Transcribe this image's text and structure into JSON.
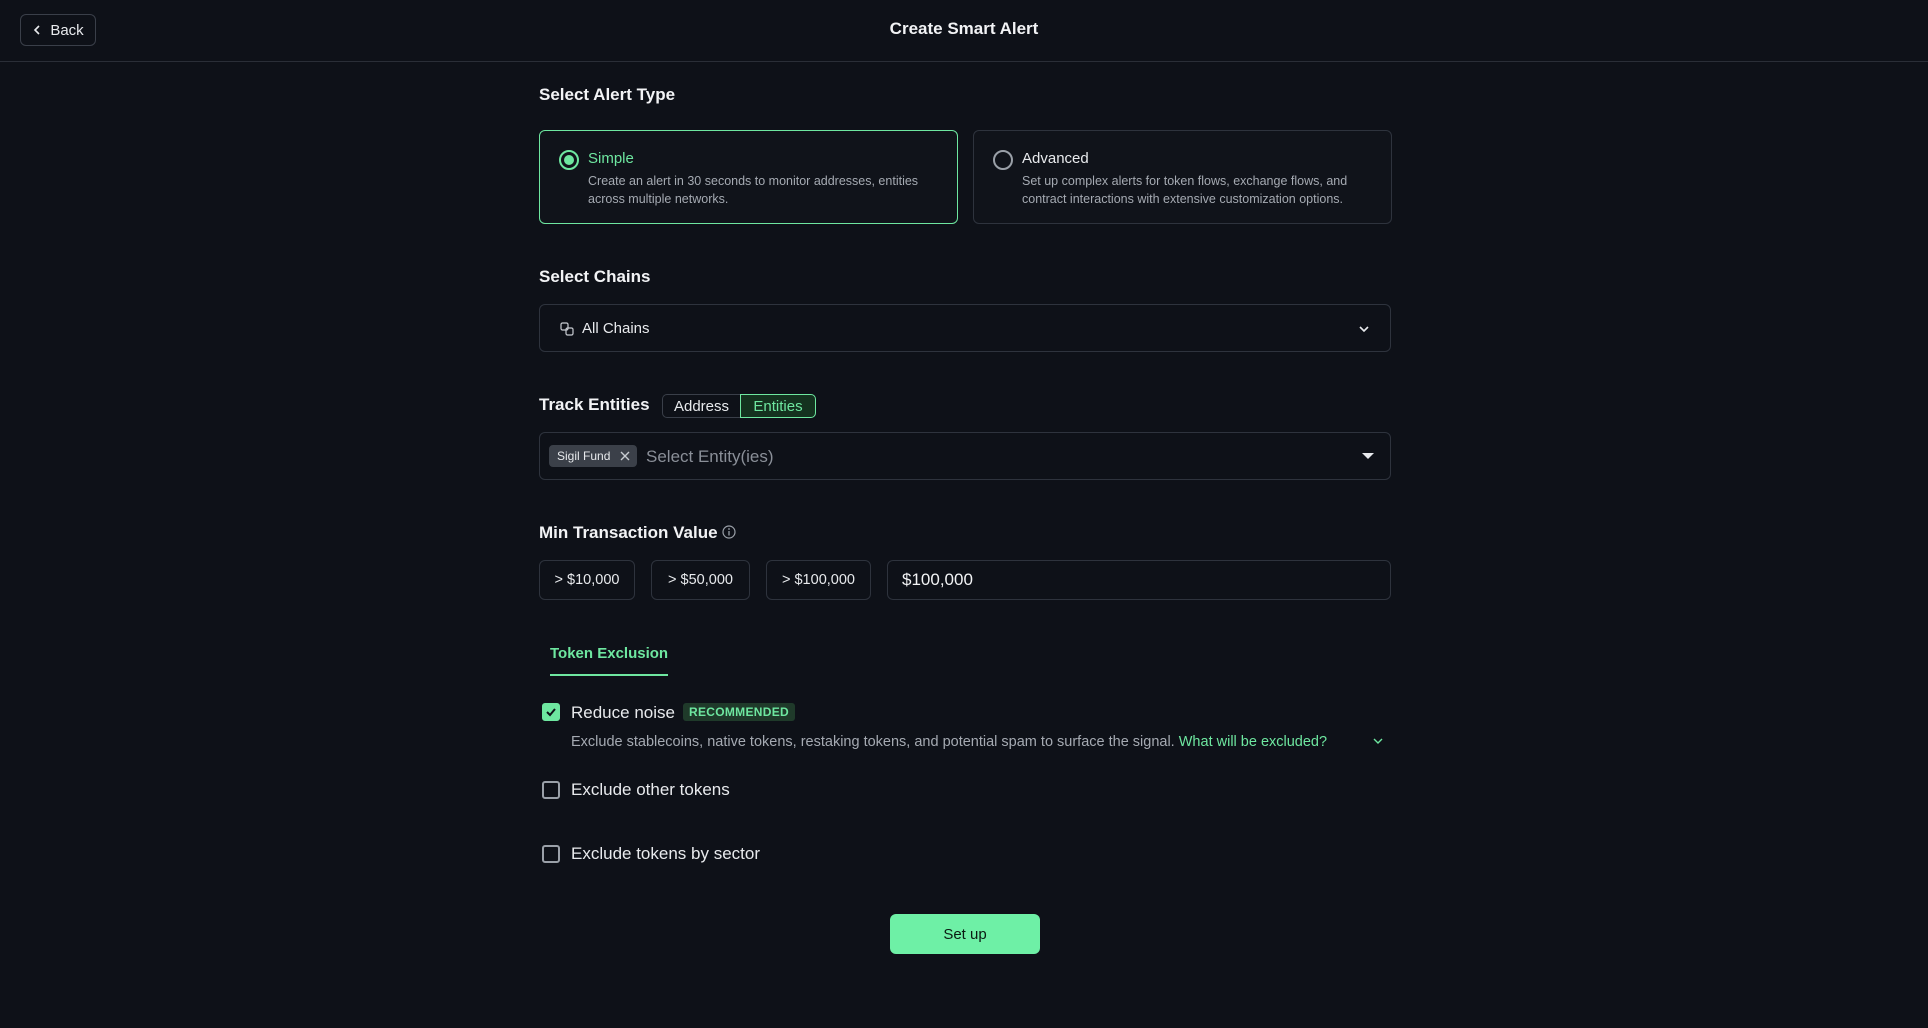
{
  "header": {
    "back_label": "Back",
    "title": "Create Smart Alert"
  },
  "alert_type": {
    "title": "Select Alert Type",
    "options": [
      {
        "name": "Simple",
        "description": "Create an alert in 30 seconds to monitor addresses, entities across multiple networks.",
        "selected": true
      },
      {
        "name": "Advanced",
        "description": "Set up complex alerts for token flows, exchange flows, and contract interactions with extensive customization options.",
        "selected": false
      }
    ]
  },
  "chains": {
    "title": "Select Chains",
    "value": "All Chains"
  },
  "track": {
    "title": "Track Entities",
    "toggle": [
      "Address",
      "Entities"
    ],
    "active": "Entities",
    "tags": [
      "Sigil Fund"
    ],
    "placeholder": "Select Entity(ies)"
  },
  "min_value": {
    "title": "Min Transaction Value",
    "presets": [
      "> $10,000",
      "> $50,000",
      "> $100,000"
    ],
    "value": "$100,000"
  },
  "token_exclusion": {
    "tab": "Token Exclusion",
    "reduce_noise": {
      "label": "Reduce noise",
      "badge": "RECOMMENDED",
      "checked": true,
      "description": "Exclude stablecoins, native tokens, restaking tokens, and potential spam to surface the signal.",
      "link": "What will be excluded?"
    },
    "exclude_other": {
      "label": "Exclude other tokens",
      "checked": false
    },
    "exclude_sector": {
      "label": "Exclude tokens by sector",
      "checked": false
    }
  },
  "setup_label": "Set up",
  "colors": {
    "accent": "#6ee7a0",
    "background": "#0e1118",
    "button": "#6ef0a6"
  }
}
